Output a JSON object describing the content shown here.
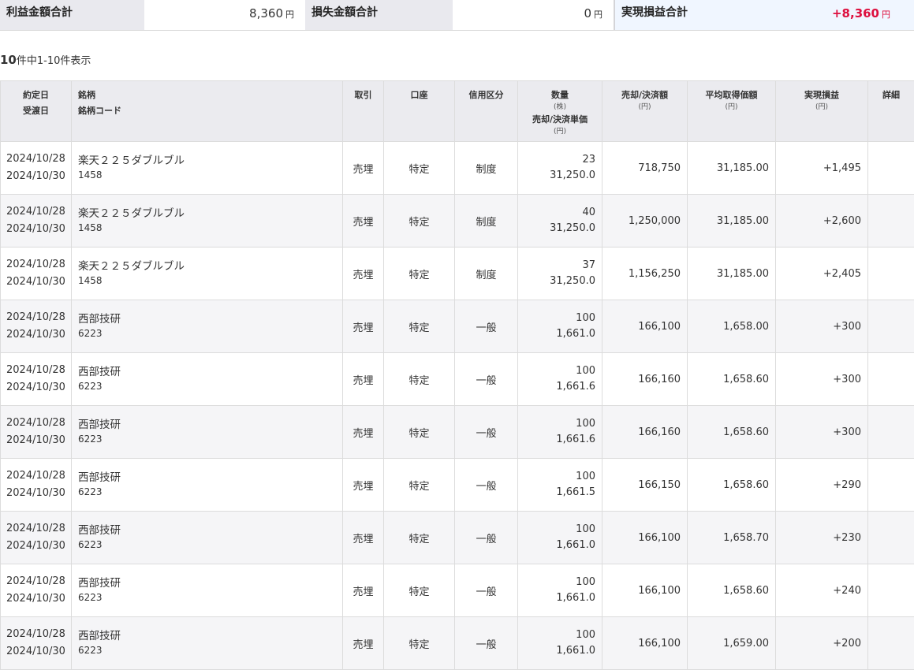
{
  "summary": {
    "profit_label": "利益金額合計",
    "profit_value": "8,360",
    "loss_label": "損失金額合計",
    "loss_value": "0",
    "realized_label": "実現損益合計",
    "realized_value": "+8,360",
    "yen": "円"
  },
  "count": {
    "total": "10",
    "text": "件中1-10件表示"
  },
  "headers": {
    "trade_date": "約定日",
    "delivery_date": "受渡日",
    "stock": "銘柄",
    "stock_code": "銘柄コード",
    "trade": "取引",
    "account": "口座",
    "margin": "信用区分",
    "quantity": "数量",
    "quantity_unit": "(株)",
    "sell_price": "売却/決済単価",
    "sell_price_unit": "(円)",
    "sell_amount": "売却/決済額",
    "sell_amount_unit": "(円)",
    "avg_cost": "平均取得価額",
    "avg_cost_unit": "(円)",
    "realized_pl": "実現損益",
    "realized_pl_unit": "(円)",
    "detail": "詳細"
  },
  "rows": [
    {
      "trade_date": "2024/10/28",
      "delivery_date": "2024/10/30",
      "name": "楽天２２５ダブルブル",
      "code": "1458",
      "trade": "売埋",
      "account": "特定",
      "margin": "制度",
      "qty": "23",
      "price": "31,250.0",
      "amount": "718,750",
      "avg_cost": "31,185.00",
      "pl": "+1,495"
    },
    {
      "trade_date": "2024/10/28",
      "delivery_date": "2024/10/30",
      "name": "楽天２２５ダブルブル",
      "code": "1458",
      "trade": "売埋",
      "account": "特定",
      "margin": "制度",
      "qty": "40",
      "price": "31,250.0",
      "amount": "1,250,000",
      "avg_cost": "31,185.00",
      "pl": "+2,600"
    },
    {
      "trade_date": "2024/10/28",
      "delivery_date": "2024/10/30",
      "name": "楽天２２５ダブルブル",
      "code": "1458",
      "trade": "売埋",
      "account": "特定",
      "margin": "制度",
      "qty": "37",
      "price": "31,250.0",
      "amount": "1,156,250",
      "avg_cost": "31,185.00",
      "pl": "+2,405"
    },
    {
      "trade_date": "2024/10/28",
      "delivery_date": "2024/10/30",
      "name": "西部技研",
      "code": "6223",
      "trade": "売埋",
      "account": "特定",
      "margin": "一般",
      "qty": "100",
      "price": "1,661.0",
      "amount": "166,100",
      "avg_cost": "1,658.00",
      "pl": "+300"
    },
    {
      "trade_date": "2024/10/28",
      "delivery_date": "2024/10/30",
      "name": "西部技研",
      "code": "6223",
      "trade": "売埋",
      "account": "特定",
      "margin": "一般",
      "qty": "100",
      "price": "1,661.6",
      "amount": "166,160",
      "avg_cost": "1,658.60",
      "pl": "+300"
    },
    {
      "trade_date": "2024/10/28",
      "delivery_date": "2024/10/30",
      "name": "西部技研",
      "code": "6223",
      "trade": "売埋",
      "account": "特定",
      "margin": "一般",
      "qty": "100",
      "price": "1,661.6",
      "amount": "166,160",
      "avg_cost": "1,658.60",
      "pl": "+300"
    },
    {
      "trade_date": "2024/10/28",
      "delivery_date": "2024/10/30",
      "name": "西部技研",
      "code": "6223",
      "trade": "売埋",
      "account": "特定",
      "margin": "一般",
      "qty": "100",
      "price": "1,661.5",
      "amount": "166,150",
      "avg_cost": "1,658.60",
      "pl": "+290"
    },
    {
      "trade_date": "2024/10/28",
      "delivery_date": "2024/10/30",
      "name": "西部技研",
      "code": "6223",
      "trade": "売埋",
      "account": "特定",
      "margin": "一般",
      "qty": "100",
      "price": "1,661.0",
      "amount": "166,100",
      "avg_cost": "1,658.70",
      "pl": "+230"
    },
    {
      "trade_date": "2024/10/28",
      "delivery_date": "2024/10/30",
      "name": "西部技研",
      "code": "6223",
      "trade": "売埋",
      "account": "特定",
      "margin": "一般",
      "qty": "100",
      "price": "1,661.0",
      "amount": "166,100",
      "avg_cost": "1,658.60",
      "pl": "+240"
    },
    {
      "trade_date": "2024/10/28",
      "delivery_date": "2024/10/30",
      "name": "西部技研",
      "code": "6223",
      "trade": "売埋",
      "account": "特定",
      "margin": "一般",
      "qty": "100",
      "price": "1,661.0",
      "amount": "166,100",
      "avg_cost": "1,659.00",
      "pl": "+200"
    }
  ],
  "colors": {
    "profit": "#dd0f3e",
    "header_bg": "#ebebef",
    "alt_row_bg": "#f5f5f7"
  }
}
